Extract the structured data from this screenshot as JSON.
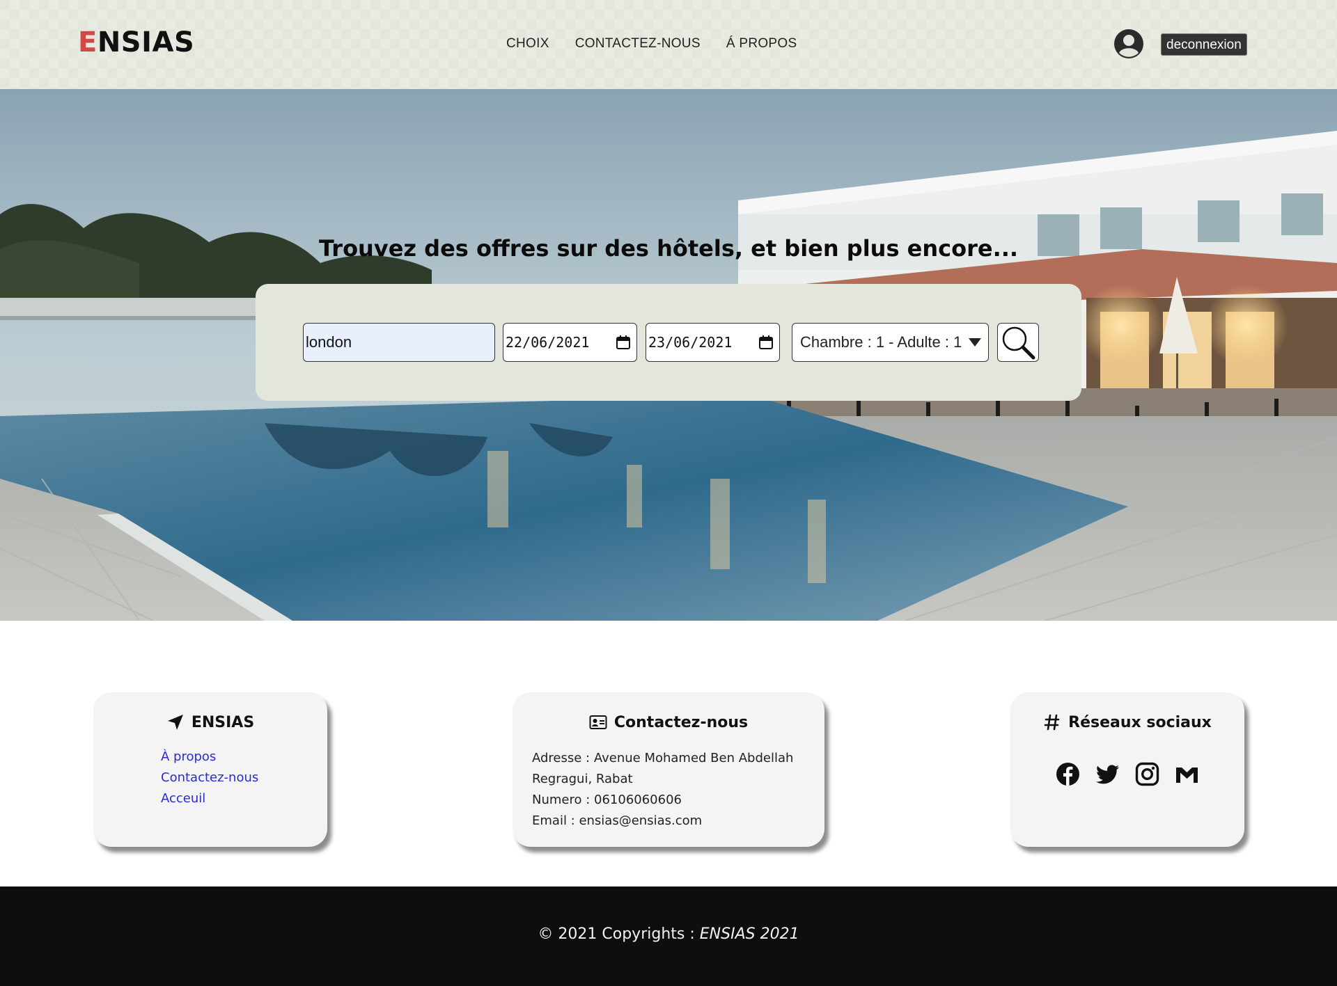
{
  "header": {
    "logo_first": "E",
    "logo_rest": "NSIAS",
    "nav": [
      "CHOIX",
      "CONTACTEZ-NOUS",
      "Á PROPOS"
    ],
    "logout_label": "deconnexion",
    "avatar_icon": "user-circle-icon"
  },
  "hero": {
    "title": "Trouvez des offres sur des hôtels, et bien plus encore..."
  },
  "search": {
    "city_value": "london",
    "checkin_value": "22/06/2021",
    "checkout_value": "23/06/2021",
    "rooms_value": "Chambre : 1 - Adulte : 1",
    "search_icon": "magnifier-icon"
  },
  "cards": {
    "about": {
      "title": "ENSIAS",
      "icon": "location-arrow-icon",
      "links": [
        "À propos",
        "Contactez-nous",
        "Acceuil"
      ]
    },
    "contact": {
      "title": "Contactez-nous",
      "icon": "address-card-icon",
      "address": "Adresse : Avenue Mohamed Ben Abdellah Regragui, Rabat",
      "phone": "Numero : 06106060606",
      "email": "Email : ensias@ensias.com"
    },
    "social": {
      "title": "Réseaux sociaux",
      "icon": "hashtag-icon",
      "networks": [
        "facebook-icon",
        "twitter-icon",
        "instagram-icon",
        "gmail-icon"
      ]
    }
  },
  "footer": {
    "copyright_prefix": "© 2021 Copyrights : ",
    "copyright_brand": "ENSIAS 2021"
  },
  "colors": {
    "header_bg": "#e2e6db",
    "logo_accent": "#d24848",
    "link": "#2a2ad0",
    "footer_bg": "#0e0e0e"
  }
}
